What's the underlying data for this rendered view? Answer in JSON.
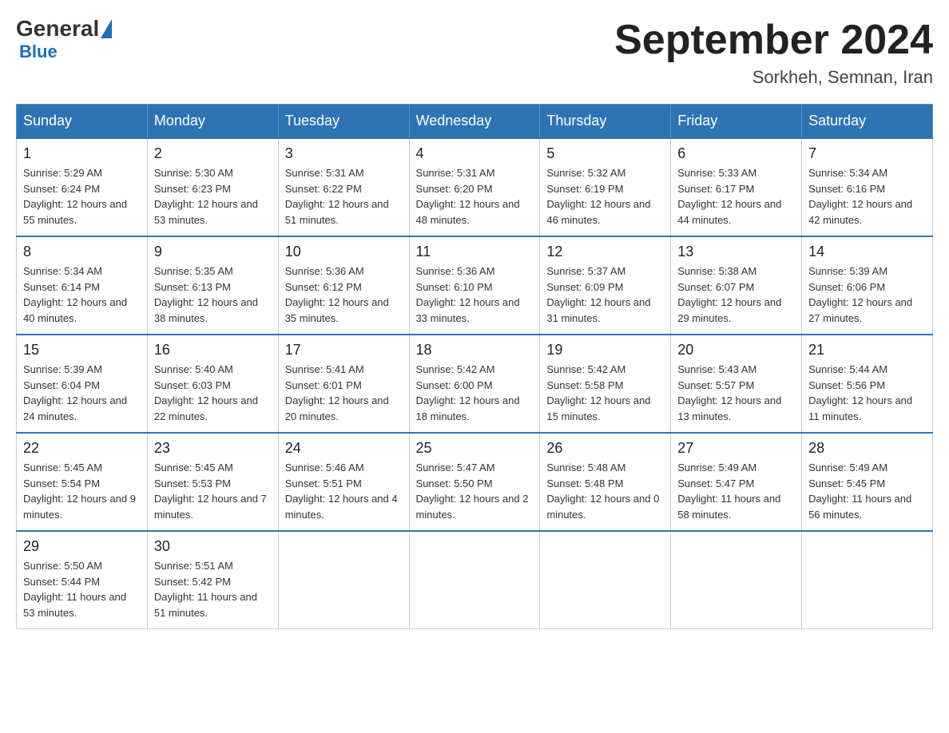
{
  "header": {
    "logo": {
      "general": "General",
      "blue": "Blue"
    },
    "title": "September 2024",
    "location": "Sorkheh, Semnan, Iran"
  },
  "weekdays": [
    "Sunday",
    "Monday",
    "Tuesday",
    "Wednesday",
    "Thursday",
    "Friday",
    "Saturday"
  ],
  "weeks": [
    [
      {
        "day": "1",
        "sunrise": "5:29 AM",
        "sunset": "6:24 PM",
        "daylight": "12 hours and 55 minutes."
      },
      {
        "day": "2",
        "sunrise": "5:30 AM",
        "sunset": "6:23 PM",
        "daylight": "12 hours and 53 minutes."
      },
      {
        "day": "3",
        "sunrise": "5:31 AM",
        "sunset": "6:22 PM",
        "daylight": "12 hours and 51 minutes."
      },
      {
        "day": "4",
        "sunrise": "5:31 AM",
        "sunset": "6:20 PM",
        "daylight": "12 hours and 48 minutes."
      },
      {
        "day": "5",
        "sunrise": "5:32 AM",
        "sunset": "6:19 PM",
        "daylight": "12 hours and 46 minutes."
      },
      {
        "day": "6",
        "sunrise": "5:33 AM",
        "sunset": "6:17 PM",
        "daylight": "12 hours and 44 minutes."
      },
      {
        "day": "7",
        "sunrise": "5:34 AM",
        "sunset": "6:16 PM",
        "daylight": "12 hours and 42 minutes."
      }
    ],
    [
      {
        "day": "8",
        "sunrise": "5:34 AM",
        "sunset": "6:14 PM",
        "daylight": "12 hours and 40 minutes."
      },
      {
        "day": "9",
        "sunrise": "5:35 AM",
        "sunset": "6:13 PM",
        "daylight": "12 hours and 38 minutes."
      },
      {
        "day": "10",
        "sunrise": "5:36 AM",
        "sunset": "6:12 PM",
        "daylight": "12 hours and 35 minutes."
      },
      {
        "day": "11",
        "sunrise": "5:36 AM",
        "sunset": "6:10 PM",
        "daylight": "12 hours and 33 minutes."
      },
      {
        "day": "12",
        "sunrise": "5:37 AM",
        "sunset": "6:09 PM",
        "daylight": "12 hours and 31 minutes."
      },
      {
        "day": "13",
        "sunrise": "5:38 AM",
        "sunset": "6:07 PM",
        "daylight": "12 hours and 29 minutes."
      },
      {
        "day": "14",
        "sunrise": "5:39 AM",
        "sunset": "6:06 PM",
        "daylight": "12 hours and 27 minutes."
      }
    ],
    [
      {
        "day": "15",
        "sunrise": "5:39 AM",
        "sunset": "6:04 PM",
        "daylight": "12 hours and 24 minutes."
      },
      {
        "day": "16",
        "sunrise": "5:40 AM",
        "sunset": "6:03 PM",
        "daylight": "12 hours and 22 minutes."
      },
      {
        "day": "17",
        "sunrise": "5:41 AM",
        "sunset": "6:01 PM",
        "daylight": "12 hours and 20 minutes."
      },
      {
        "day": "18",
        "sunrise": "5:42 AM",
        "sunset": "6:00 PM",
        "daylight": "12 hours and 18 minutes."
      },
      {
        "day": "19",
        "sunrise": "5:42 AM",
        "sunset": "5:58 PM",
        "daylight": "12 hours and 15 minutes."
      },
      {
        "day": "20",
        "sunrise": "5:43 AM",
        "sunset": "5:57 PM",
        "daylight": "12 hours and 13 minutes."
      },
      {
        "day": "21",
        "sunrise": "5:44 AM",
        "sunset": "5:56 PM",
        "daylight": "12 hours and 11 minutes."
      }
    ],
    [
      {
        "day": "22",
        "sunrise": "5:45 AM",
        "sunset": "5:54 PM",
        "daylight": "12 hours and 9 minutes."
      },
      {
        "day": "23",
        "sunrise": "5:45 AM",
        "sunset": "5:53 PM",
        "daylight": "12 hours and 7 minutes."
      },
      {
        "day": "24",
        "sunrise": "5:46 AM",
        "sunset": "5:51 PM",
        "daylight": "12 hours and 4 minutes."
      },
      {
        "day": "25",
        "sunrise": "5:47 AM",
        "sunset": "5:50 PM",
        "daylight": "12 hours and 2 minutes."
      },
      {
        "day": "26",
        "sunrise": "5:48 AM",
        "sunset": "5:48 PM",
        "daylight": "12 hours and 0 minutes."
      },
      {
        "day": "27",
        "sunrise": "5:49 AM",
        "sunset": "5:47 PM",
        "daylight": "11 hours and 58 minutes."
      },
      {
        "day": "28",
        "sunrise": "5:49 AM",
        "sunset": "5:45 PM",
        "daylight": "11 hours and 56 minutes."
      }
    ],
    [
      {
        "day": "29",
        "sunrise": "5:50 AM",
        "sunset": "5:44 PM",
        "daylight": "11 hours and 53 minutes."
      },
      {
        "day": "30",
        "sunrise": "5:51 AM",
        "sunset": "5:42 PM",
        "daylight": "11 hours and 51 minutes."
      },
      null,
      null,
      null,
      null,
      null
    ]
  ]
}
